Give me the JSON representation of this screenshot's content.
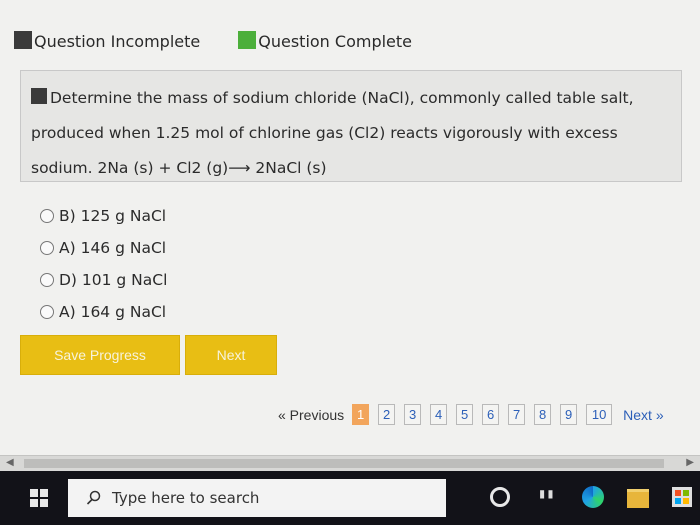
{
  "legend": {
    "incomplete": "Question Incomplete",
    "complete": "Question Complete"
  },
  "question": {
    "line1": "Determine the mass of sodium chloride (NaCl), commonly called table salt,",
    "line2": "produced when 1.25 mol of chlorine gas (Cl2) reacts vigorously with excess",
    "line3": "sodium. 2Na (s) + Cl2 (g)⟶ 2NaCl (s)"
  },
  "options": [
    {
      "label": "B) 125 g NaCl"
    },
    {
      "label": "A) 146 g NaCl"
    },
    {
      "label": "D) 101 g NaCl"
    },
    {
      "label": "A) 164 g NaCl"
    }
  ],
  "buttons": {
    "save": "Save Progress",
    "next": "Next"
  },
  "pager": {
    "previous": "« Previous",
    "pages": [
      "1",
      "2",
      "3",
      "4",
      "5",
      "6",
      "7",
      "8",
      "9",
      "10"
    ],
    "current": "1",
    "next": "Next »"
  },
  "taskbar": {
    "search_placeholder": "Type here to search"
  },
  "colors": {
    "incomplete": "#3a3a3a",
    "complete": "#4caf3b",
    "button": "#e8be14",
    "active_page": "#f2a55c",
    "link": "#2c5fb8"
  }
}
